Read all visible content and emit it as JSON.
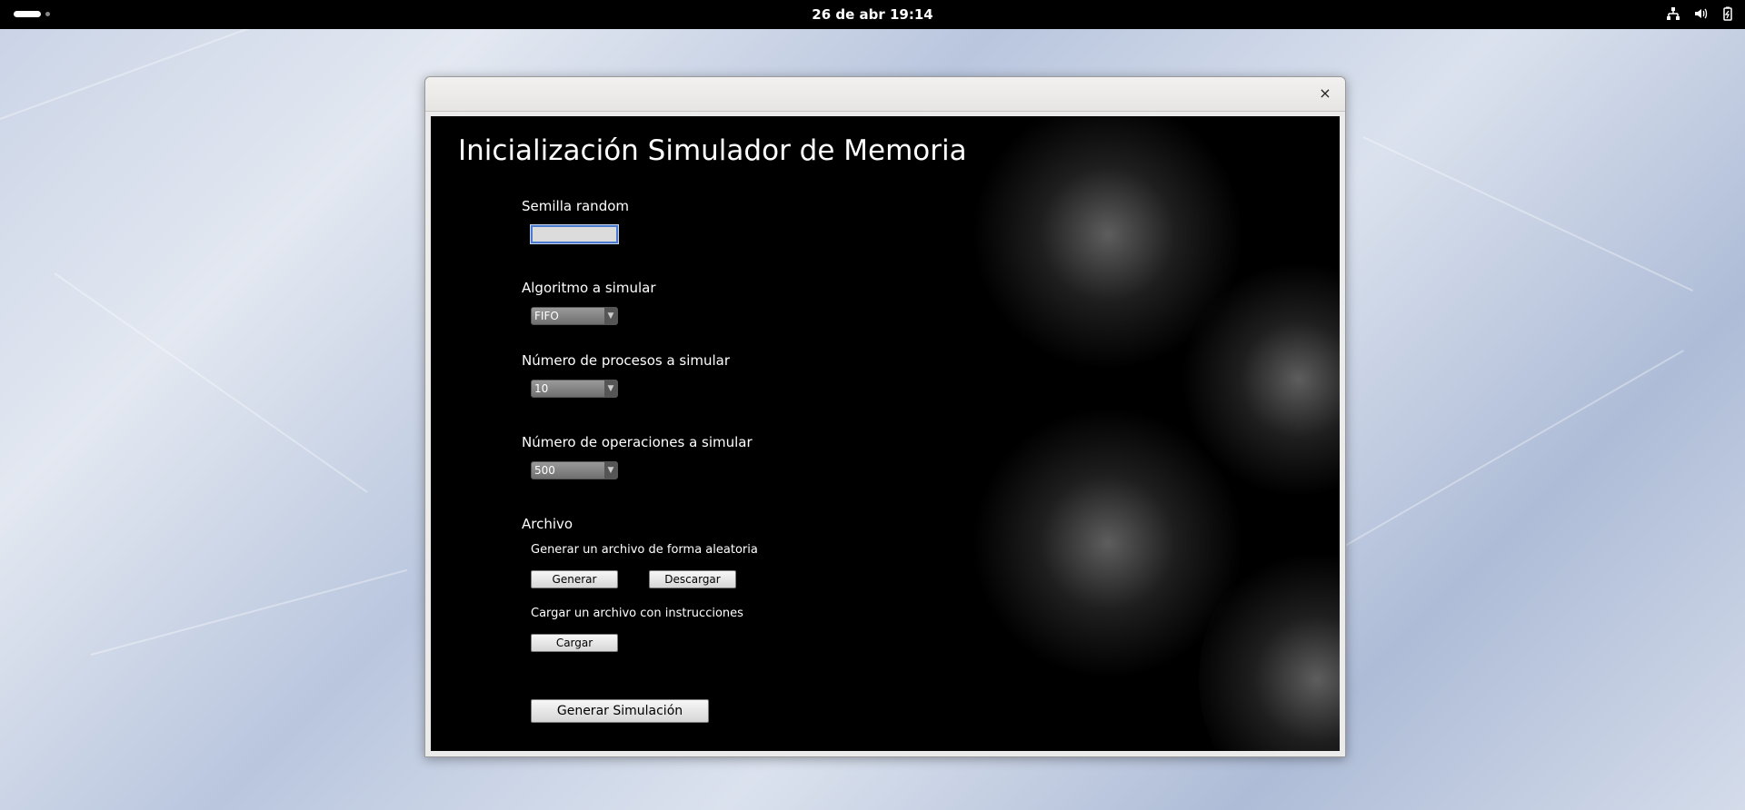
{
  "topbar": {
    "clock": "26 de abr  19:14",
    "tray_icons": [
      "network-icon",
      "volume-icon",
      "battery-icon"
    ]
  },
  "window": {
    "close_glyph": "×",
    "title": "Inicialización Simulador de Memoria",
    "seed": {
      "label": "Semilla random",
      "value": ""
    },
    "algorithm": {
      "label": "Algoritmo a simular",
      "selected": "FIFO"
    },
    "processes": {
      "label": "Número de procesos a simular",
      "selected": "10"
    },
    "operations": {
      "label": "Número de operaciones a simular",
      "selected": "500"
    },
    "file": {
      "label": "Archivo",
      "generate_text": "Generar un archivo de forma aleatoria",
      "generate_button": "Generar",
      "download_button": "Descargar",
      "load_text": "Cargar un archivo con instrucciones",
      "load_button": "Cargar"
    },
    "start_button": "Generar Simulación"
  }
}
